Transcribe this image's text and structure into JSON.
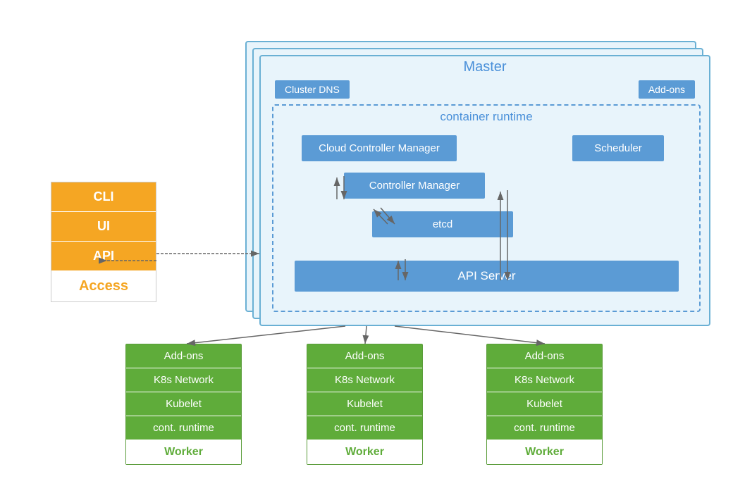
{
  "access": {
    "rows": [
      "CLI",
      "UI",
      "API"
    ],
    "label": "Access"
  },
  "master": {
    "title": "Master",
    "cluster_dns": "Cluster DNS",
    "addons_top": "Add-ons",
    "container_runtime_label": "container runtime",
    "cloud_controller_manager": "Cloud Controller Manager",
    "controller_manager": "Controller Manager",
    "scheduler": "Scheduler",
    "etcd": "etcd",
    "api_server": "API Server"
  },
  "workers": [
    {
      "rows": [
        "Add-ons",
        "K8s Network",
        "Kubelet",
        "cont. runtime"
      ],
      "label": "Worker"
    },
    {
      "rows": [
        "Add-ons",
        "K8s Network",
        "Kubelet",
        "cont. runtime"
      ],
      "label": "Worker"
    },
    {
      "rows": [
        "Add-ons",
        "K8s Network",
        "Kubelet",
        "cont. runtime"
      ],
      "label": "Worker"
    }
  ]
}
